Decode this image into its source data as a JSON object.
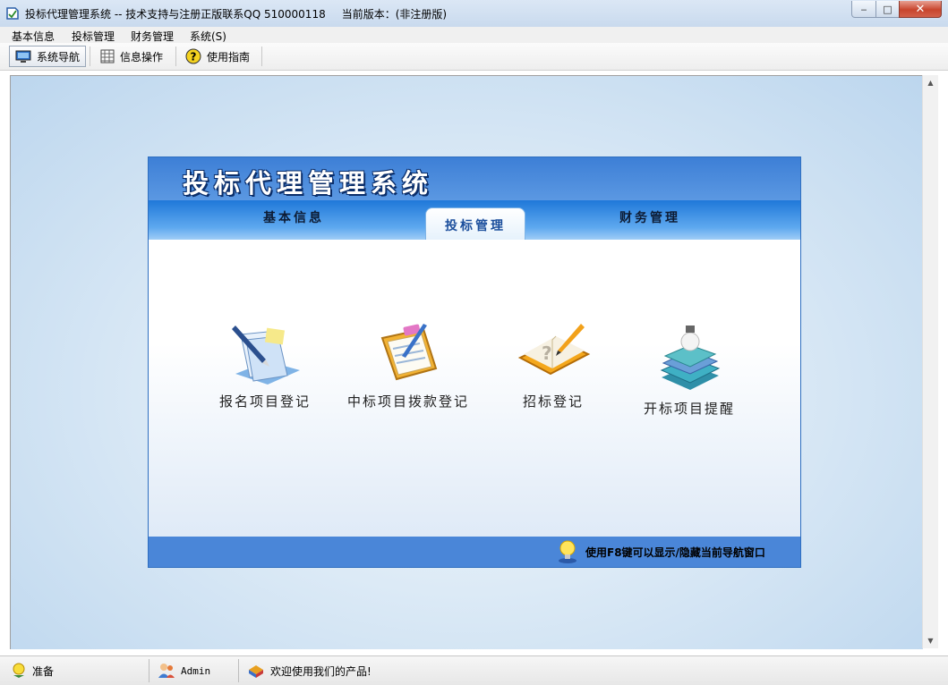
{
  "window": {
    "title": "投标代理管理系统 -- 技术支持与注册正版联系QQ 510000118",
    "version_label": "当前版本：(非注册版)",
    "minimize_label": "‒",
    "maximize_label": "□",
    "close_label": "✕"
  },
  "menu": {
    "items": [
      "基本信息",
      "投标管理",
      "财务管理",
      "系统(S)"
    ]
  },
  "toolbar": {
    "buttons": [
      {
        "label": "系统导航",
        "icon": "monitor-icon"
      },
      {
        "label": "信息操作",
        "icon": "grid-icon"
      },
      {
        "label": "使用指南",
        "icon": "help-icon"
      }
    ]
  },
  "panel": {
    "title": "投标代理管理系统",
    "tabs": [
      "基本信息",
      "投标管理",
      "财务管理"
    ],
    "active_tab": "投标管理",
    "launchers": [
      {
        "label": "报名项目登记",
        "icon": "document-pen-icon"
      },
      {
        "label": "中标项目拨款登记",
        "icon": "clipboard-icon"
      },
      {
        "label": "招标登记",
        "icon": "notebook-pencil-icon"
      },
      {
        "label": "开标项目提醒",
        "icon": "books-bulb-icon"
      }
    ],
    "hint": "使用F8键可以显示/隐藏当前导航窗口"
  },
  "status": {
    "state": "准备",
    "user": "Admin",
    "message": "欢迎使用我们的产品!"
  },
  "colors": {
    "header_blue": "#3d7fd6",
    "tab_blue": "#1f78d9",
    "footer_blue": "#4a86d8",
    "close_red": "#c8452d"
  }
}
